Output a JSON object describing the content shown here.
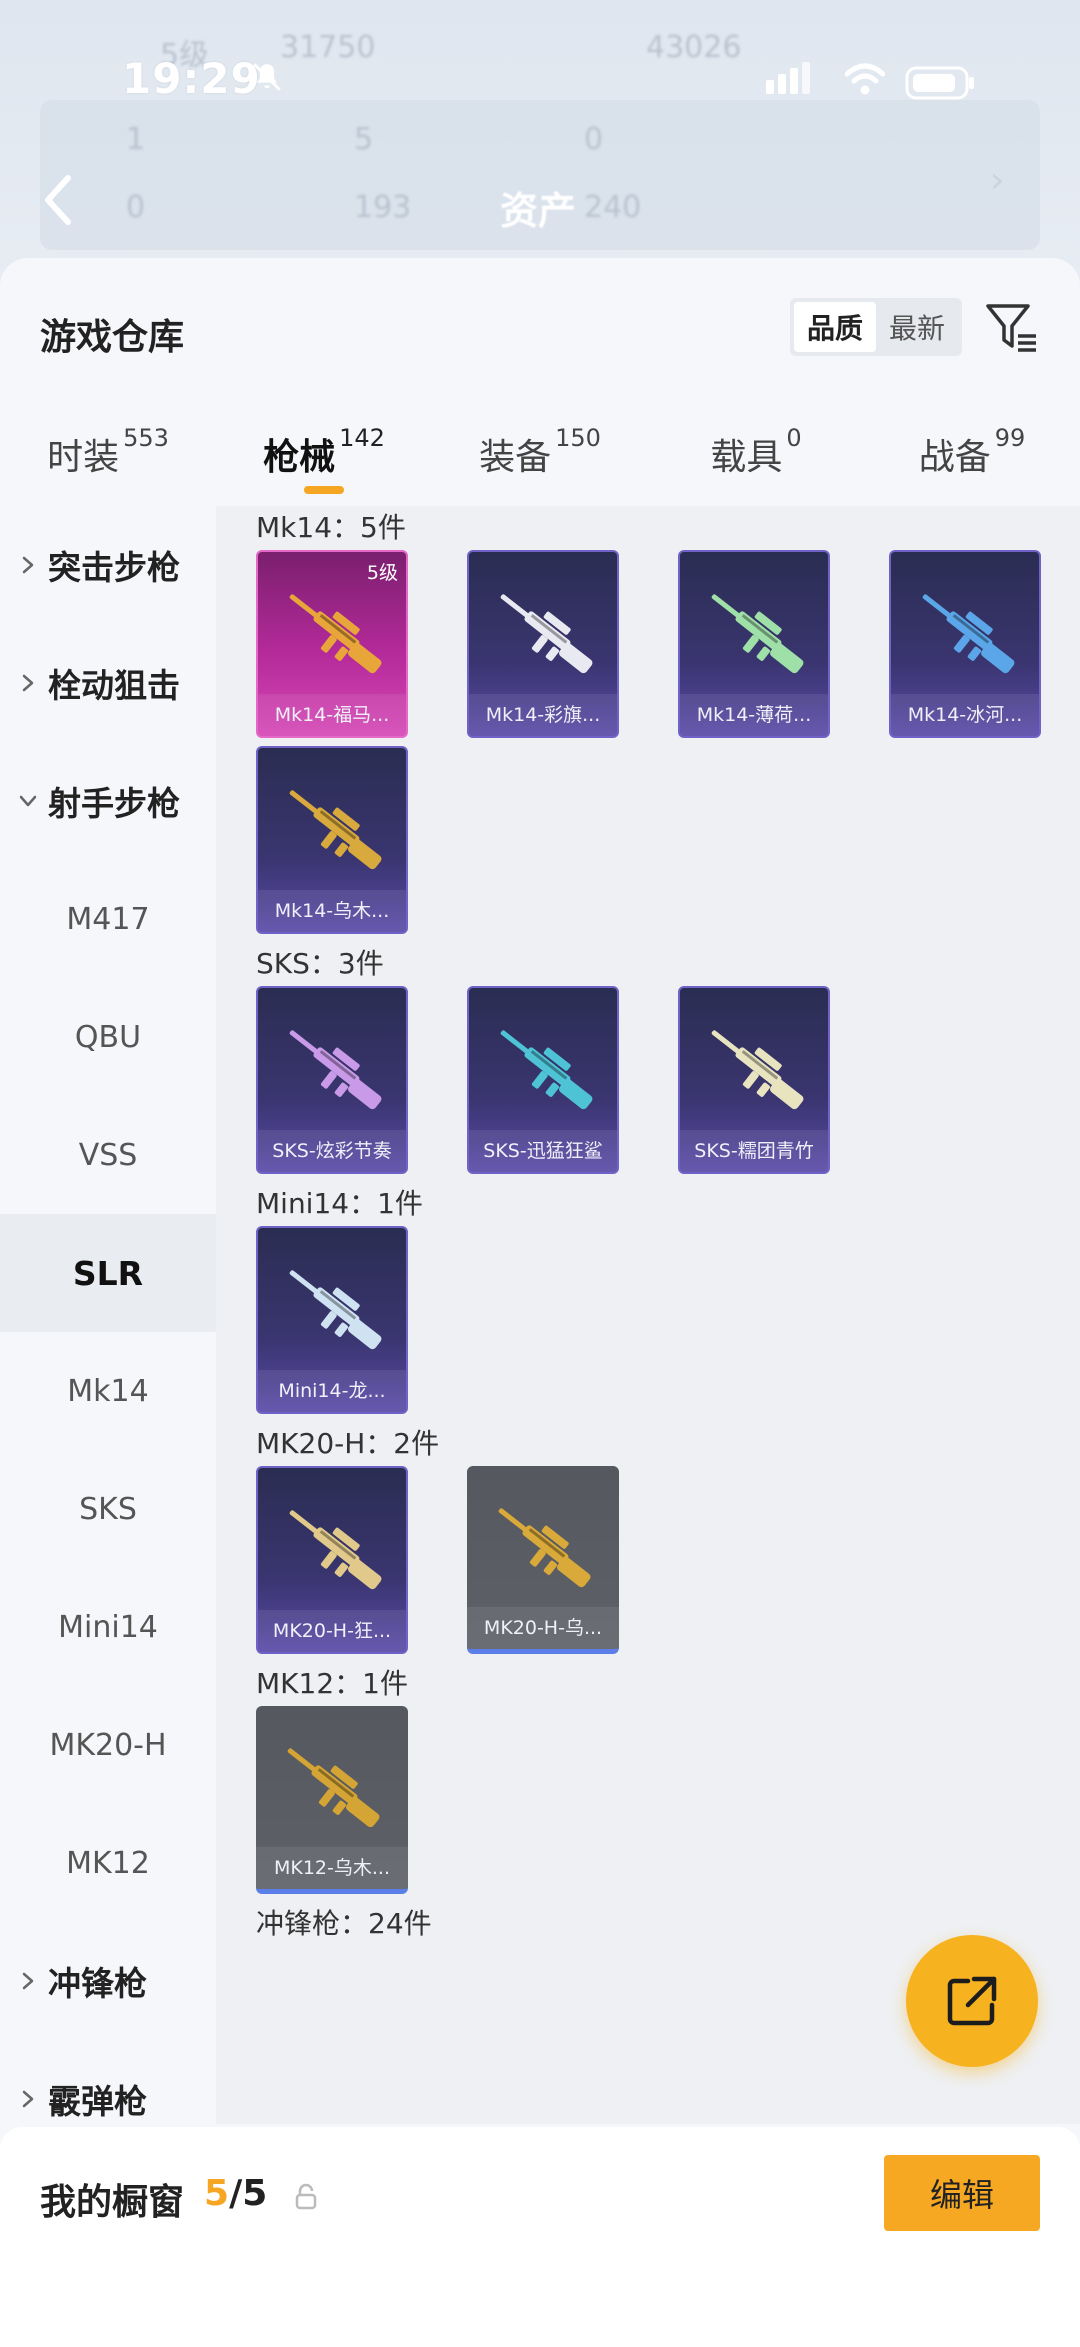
{
  "status_bar": {
    "time": "19:29"
  },
  "background_header": {
    "title": "资产",
    "ghost_texts": [
      "5级",
      "31750",
      "43026",
      "1",
      "5",
      "0",
      "0",
      "193",
      "240"
    ]
  },
  "sheet": {
    "title": "游戏仓库",
    "sort_options": [
      "品质",
      "最新"
    ],
    "sort_active": "品质"
  },
  "tabs": [
    {
      "label": "时装",
      "count": "553"
    },
    {
      "label": "枪械",
      "count": "142",
      "active": true
    },
    {
      "label": "装备",
      "count": "150"
    },
    {
      "label": "载具",
      "count": "0"
    },
    {
      "label": "战备",
      "count": "99"
    }
  ],
  "sidebar": [
    {
      "label": "突击步枪",
      "type": "group",
      "expanded": false
    },
    {
      "label": "栓动狙击",
      "type": "group",
      "expanded": false
    },
    {
      "label": "射手步枪",
      "type": "group",
      "expanded": true
    },
    {
      "label": "M417",
      "type": "sub"
    },
    {
      "label": "QBU",
      "type": "sub"
    },
    {
      "label": "VSS",
      "type": "sub"
    },
    {
      "label": "SLR",
      "type": "sub",
      "selected": true
    },
    {
      "label": "Mk14",
      "type": "sub"
    },
    {
      "label": "SKS",
      "type": "sub"
    },
    {
      "label": "Mini14",
      "type": "sub"
    },
    {
      "label": "MK20-H",
      "type": "sub"
    },
    {
      "label": "MK12",
      "type": "sub"
    },
    {
      "label": "冲锋枪",
      "type": "group",
      "expanded": false
    },
    {
      "label": "霰弹枪",
      "type": "group",
      "expanded": false
    }
  ],
  "groups": [
    {
      "title": "Mk14：5件",
      "items": [
        {
          "name": "Mk14-福马...",
          "level": "5级",
          "rarity": "pink",
          "gun_color": "#e8a53a"
        },
        {
          "name": "Mk14-彩旗...",
          "rarity": "purple",
          "gun_color": "#e9e9f2"
        },
        {
          "name": "Mk14-薄荷...",
          "rarity": "purple",
          "gun_color": "#9fe0a8"
        },
        {
          "name": "Mk14-冰河...",
          "rarity": "purple",
          "gun_color": "#5aa6e8"
        },
        {
          "name": "Mk14-乌木...",
          "rarity": "purple",
          "gun_color": "#d8a93c"
        }
      ]
    },
    {
      "title": "SKS：3件",
      "items": [
        {
          "name": "SKS-炫彩节奏",
          "rarity": "purple",
          "gun_color": "#c89ae8"
        },
        {
          "name": "SKS-迅猛狂鲨",
          "rarity": "purple",
          "gun_color": "#4fc3d6"
        },
        {
          "name": "SKS-糯团青竹",
          "rarity": "purple",
          "gun_color": "#e8e4c0"
        }
      ]
    },
    {
      "title": "Mini14：1件",
      "items": [
        {
          "name": "Mini14-龙...",
          "rarity": "purple",
          "gun_color": "#cfe2f2"
        }
      ]
    },
    {
      "title": "MK20-H：2件",
      "items": [
        {
          "name": "MK20-H-狂...",
          "rarity": "purple",
          "gun_color": "#e0c98a"
        },
        {
          "name": "MK20-H-乌...",
          "rarity": "gray",
          "gun_color": "#d9a93a"
        }
      ]
    },
    {
      "title": "MK12：1件",
      "items": [
        {
          "name": "MK12-乌木...",
          "rarity": "gray",
          "gun_color": "#d4a534"
        }
      ]
    },
    {
      "title": "冲锋枪：24件",
      "items": []
    }
  ],
  "bottom_bar": {
    "label": "我的橱窗",
    "count_current": "5",
    "count_sep_total": "/5",
    "edit_label": "编辑"
  },
  "colors": {
    "accent": "#f5a623",
    "fab": "#f7b21f"
  },
  "icons": [
    "back-arrow-icon",
    "bell-muted-icon",
    "signal-icon",
    "wifi-icon",
    "battery-icon",
    "filter-icon",
    "chevron-right-icon",
    "chevron-down-icon",
    "share-external-icon",
    "lock-icon"
  ]
}
